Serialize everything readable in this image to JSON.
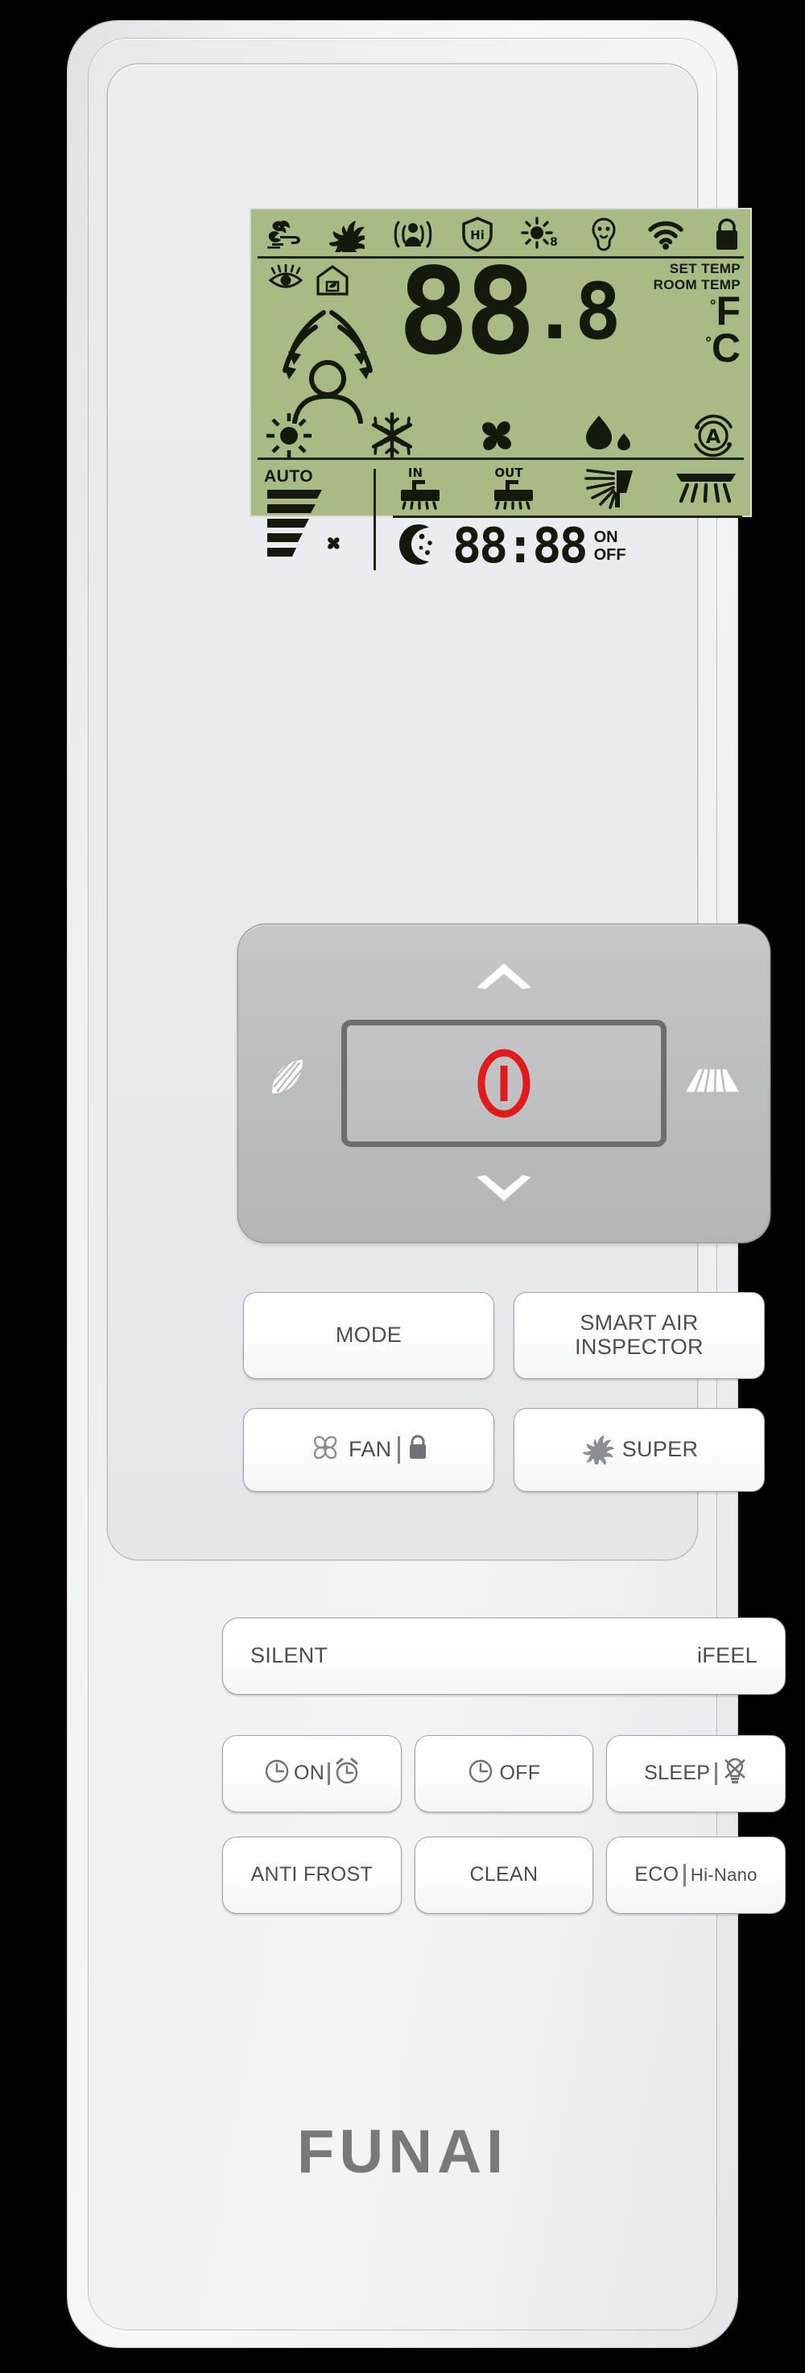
{
  "device": {
    "brand": "FUNAI",
    "type": "air-conditioner-remote"
  },
  "colors": {
    "lcd_background": "#a8bb84",
    "lcd_segment": "#14190c",
    "body": "#eef0f2",
    "dpad_plate": "#bcbdbf",
    "power_red": "#e01b1b",
    "button_text": "#4a4d52",
    "brand_text": "#77797d"
  },
  "lcd": {
    "status_icons": [
      {
        "name": "air-flow-leaf-icon",
        "label": "fresh air"
      },
      {
        "name": "turbo-swirl-icon",
        "label": "turbo"
      },
      {
        "name": "human-sensor-icon",
        "label": "presence sensor"
      },
      {
        "name": "hi-shield-icon",
        "label": "Hi shield"
      },
      {
        "name": "sterilize-sun-icon",
        "label": "sterilization"
      },
      {
        "name": "air-quality-face-icon",
        "label": "air quality"
      },
      {
        "name": "wifi-icon",
        "label": "wifi"
      },
      {
        "name": "lock-icon",
        "label": "child lock"
      }
    ],
    "mid_icons": [
      {
        "name": "eye-ifeel-icon",
        "label": "iFeel eye"
      },
      {
        "name": "home-eco-icon",
        "label": "home"
      }
    ],
    "person_swing_icon": "person-airflow-icon",
    "temperature": {
      "integer": "88",
      "decimal": ".8",
      "set_temp_label": "SET TEMP",
      "room_temp_label": "ROOM TEMP",
      "unit_f": "F",
      "unit_c": "C",
      "degree": "°"
    },
    "mode_icons": [
      {
        "name": "heat-sun-icon",
        "label": "heat"
      },
      {
        "name": "cool-snowflake-icon",
        "label": "cool"
      },
      {
        "name": "fan-blade-icon",
        "label": "fan"
      },
      {
        "name": "dry-droplet-icon",
        "label": "dry"
      },
      {
        "name": "auto-a-icon",
        "label": "auto"
      }
    ],
    "fan": {
      "auto_label": "AUTO",
      "bars_icon": "fan-speed-bars-icon",
      "fan_icon": "fan-small-icon"
    },
    "swing_icons": [
      {
        "name": "swing-in-icon",
        "label": "IN"
      },
      {
        "name": "swing-out-icon",
        "label": "OUT"
      },
      {
        "name": "vertical-swing-icon",
        "label": "vertical swing"
      },
      {
        "name": "horizontal-swing-icon",
        "label": "horizontal swing"
      }
    ],
    "swing_labels": {
      "in": "IN",
      "out": "OUT"
    },
    "timer": {
      "moon_icon": "sleep-moon-icon",
      "value": "88:88",
      "on_label": "ON",
      "off_label": "OFF"
    }
  },
  "dpad": {
    "power_icon": "power-icon",
    "up_icon": "chevron-up-icon",
    "down_icon": "chevron-down-icon",
    "left_icon": "vertical-swing-icon",
    "right_icon": "horizontal-swing-icon"
  },
  "buttons": {
    "mode": "MODE",
    "smart_air_line1": "SMART AIR",
    "smart_air_line2": "INSPECTOR",
    "fan": "FAN",
    "fan_lock_icon": "lock-icon",
    "fan_icon": "fan-blade-icon",
    "super": "SUPER",
    "super_icon": "turbo-swirl-icon",
    "silent": "SILENT",
    "ifeel": "iFEEL",
    "timer_on": "ON",
    "timer_on_icon": "clock-icon",
    "timer_on_alarm_icon": "alarm-clock-icon",
    "timer_off": "OFF",
    "timer_off_icon": "clock-icon",
    "sleep": "SLEEP",
    "sleep_light_icon": "light-off-icon",
    "anti_frost": "ANTI FROST",
    "clean": "CLEAN",
    "eco": "ECO",
    "hi_nano": "Hi-Nano"
  }
}
